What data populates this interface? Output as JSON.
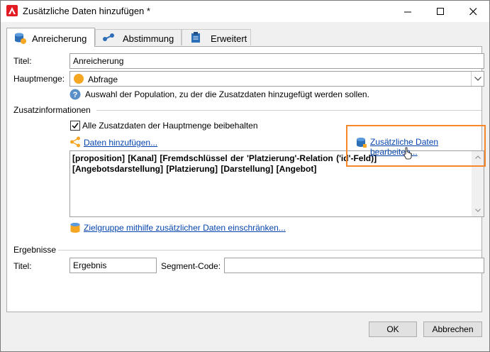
{
  "window": {
    "title": "Zusätzliche Daten hinzufügen *",
    "accent_color": "#e31b23"
  },
  "tabs": [
    {
      "label": "Anreicherung",
      "active": true
    },
    {
      "label": "Abstimmung",
      "active": false
    },
    {
      "label": "Erweitert",
      "active": false
    }
  ],
  "form": {
    "title_label": "Titel:",
    "title_value": "Anreicherung",
    "main_set_label": "Hauptmenge:",
    "main_set_value": "Abfrage",
    "main_set_hint": "Auswahl der Population, zu der die Zusatzdaten hinzugefügt werden sollen."
  },
  "additional_info": {
    "section_label": "Zusatzinformationen",
    "keep_all_label": "Alle Zusatzdaten der Hauptmenge beibehalten",
    "keep_all_checked": true,
    "add_data_link": "Daten hinzufügen...",
    "edit_data_link": "Zusätzliche Daten bearbeiten...",
    "data_text": "[proposition]  [Kanal]  [Fremdschlüssel der 'Platzierung'-Relation ('id'-Feld)]  [Angebotsdarstellung] [Platzierung]  [Darstellung] [Angebot]",
    "restrict_link": "Zielgruppe mithilfe zusätzlicher Daten einschränken..."
  },
  "results": {
    "section_label": "Ergebnisse",
    "title_label": "Titel:",
    "title_value": "Ergebnis",
    "segment_code_label": "Segment-Code:",
    "segment_code_value": ""
  },
  "buttons": {
    "ok": "OK",
    "cancel": "Abbrechen"
  },
  "highlight_color": "#f5882a"
}
